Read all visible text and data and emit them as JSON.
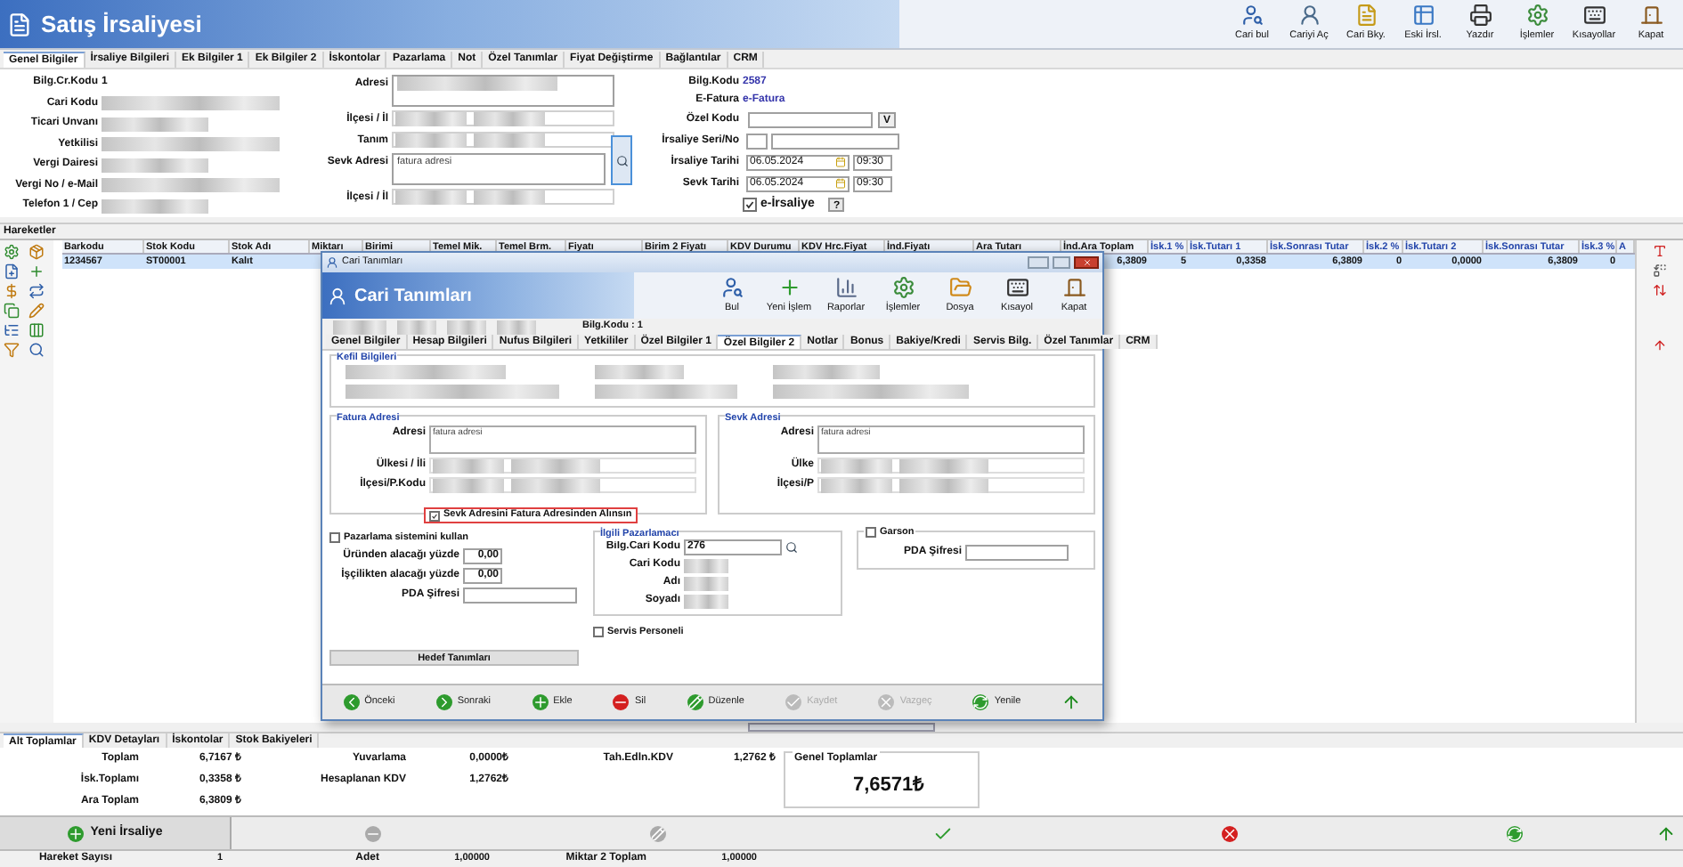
{
  "window": {
    "title": "Satış İrsaliyesi"
  },
  "toolbar": [
    {
      "label": "Cari bul"
    },
    {
      "label": "Cariyi Aç"
    },
    {
      "label": "Cari Bky."
    },
    {
      "label": "Eski İrsl."
    },
    {
      "label": "Yazdır"
    },
    {
      "label": "İşlemler"
    },
    {
      "label": "Kısayollar"
    },
    {
      "label": "Kapat"
    }
  ],
  "tabs": [
    {
      "label": "Genel Bilgiler",
      "selected": true
    },
    {
      "label": "İrsaliye Bilgileri",
      "selected": false
    },
    {
      "label": "Ek Bilgiler 1",
      "selected": false
    },
    {
      "label": "Ek Bilgiler 2",
      "selected": false
    },
    {
      "label": "İskontolar",
      "selected": false
    },
    {
      "label": "Pazarlama",
      "selected": false
    },
    {
      "label": "Not",
      "selected": false
    },
    {
      "label": "Özel Tanımlar",
      "selected": false
    },
    {
      "label": "Fiyat Değiştirme",
      "selected": false
    },
    {
      "label": "Bağlantılar",
      "selected": false
    },
    {
      "label": "CRM",
      "selected": false
    }
  ],
  "customer_fields": [
    {
      "label": "Bilg.Cr.Kodu",
      "value": "1"
    },
    {
      "label": "Cari Kodu"
    },
    {
      "label": "Ticari Unvanı"
    },
    {
      "label": "Yetkilisi"
    },
    {
      "label": "Vergi Dairesi"
    },
    {
      "label": "Vergi No / e-Mail"
    },
    {
      "label": "Telefon 1 / Cep"
    }
  ],
  "address_fields": [
    {
      "label": "Adresi",
      "kind": "area"
    },
    {
      "label": "İlçesi / İl",
      "kind": "line"
    },
    {
      "label": "Tanım",
      "kind": "line"
    },
    {
      "label": "Sevk Adresi",
      "kind": "area",
      "value": "fatura adresi"
    },
    {
      "label": "İlçesi / İl",
      "kind": "line"
    }
  ],
  "document_fields": {
    "bilg_kodu": {
      "label": "Bilg.Kodu",
      "value": "2587"
    },
    "e_fatura": {
      "label": "E-Fatura",
      "value": "e-Fatura"
    },
    "ozel_kodu": {
      "label": "Özel Kodu",
      "button": "V"
    },
    "seri_no": {
      "label": "İrsaliye Seri/No"
    },
    "irsaliye_tarihi": {
      "label": "İrsaliye Tarihi",
      "date": "06.05.2024",
      "time": "09:30"
    },
    "sevk_tarihi": {
      "label": "Sevk Tarihi",
      "date": "06.05.2024",
      "time": "09:30"
    },
    "e_irsaliye": {
      "label": "e-İrsaliye",
      "checked": true
    },
    "help_button": "?"
  },
  "movements": {
    "title": "Hareketler",
    "columns": [
      "Barkodu",
      "Stok Kodu",
      "Stok Adı",
      "Miktarı",
      "Birimi",
      "Temel Mik.",
      "Temel Brm.",
      "Fiyatı",
      "Birim 2 Fiyatı",
      "KDV Durumu",
      "KDV Hrc.Fiyat",
      "İnd.Fiyatı",
      "Ara Tutarı",
      "İnd.Ara Toplam",
      "İsk.1 %",
      "İsk.Tutarı 1",
      "İsk.Sonrası Tutar",
      "İsk.2 %",
      "İsk.Tutarı 2",
      "İsk.Sonrası Tutar",
      "İsk.3 %",
      "A"
    ],
    "rows": [
      {
        "selected": true,
        "cells": [
          "1234567",
          "ST00001",
          "Kalıt",
          null,
          null,
          null,
          null,
          null,
          null,
          null,
          null,
          null,
          null,
          "6,3809",
          "5",
          "0,3358",
          "6,3809",
          "0",
          "0,0000",
          "6,3809",
          "0",
          null
        ]
      }
    ]
  },
  "dialog": {
    "window_title": "Cari Tanımları",
    "title": "Cari Tanımları",
    "toolbar": [
      {
        "label": "Bul"
      },
      {
        "label": "Yeni İşlem"
      },
      {
        "label": "Raporlar"
      },
      {
        "label": "İşlemler"
      },
      {
        "label": "Dosya"
      },
      {
        "label": "Kısayol"
      },
      {
        "label": "Kapat"
      }
    ],
    "code": "Bilg.Kodu : 1",
    "tabs": [
      {
        "label": "Genel Bilgiler",
        "selected": false
      },
      {
        "label": "Hesap Bilgileri",
        "selected": false
      },
      {
        "label": "Nufus Bilgileri",
        "selected": false
      },
      {
        "label": "Yetkililer",
        "selected": false
      },
      {
        "label": "Özel Bilgiler 1",
        "selected": false
      },
      {
        "label": "Özel Bilgiler 2",
        "selected": true
      },
      {
        "label": "Notlar",
        "selected": false
      },
      {
        "label": "Bonus",
        "selected": false
      },
      {
        "label": "Bakiye/Kredi",
        "selected": false
      },
      {
        "label": "Servis Bilg.",
        "selected": false
      },
      {
        "label": "Özel Tanımlar",
        "selected": false
      },
      {
        "label": "CRM",
        "selected": false
      }
    ],
    "guarantor": {
      "title": "Kefil Bilgileri"
    },
    "invoice_address": {
      "title": "Fatura Adresi",
      "fields": [
        {
          "label": "Adresi",
          "value": "fatura adresi"
        },
        {
          "label": "Ülkesi / İli"
        },
        {
          "label": "İlçesi/P.Kodu"
        }
      ]
    },
    "shipping_address": {
      "title": "Sevk Adresi",
      "fields": [
        {
          "label": "Adresi",
          "value": "fatura adresi"
        },
        {
          "label": "Ülke"
        },
        {
          "label": "İlçesi/P"
        }
      ]
    },
    "same_address": {
      "label": "Sevk Adresini Fatura Adresinden Alınsın",
      "checked": true
    },
    "marketing": {
      "label": "Pazarlama sistemini kullan",
      "checked": false,
      "fields": [
        {
          "label": "Üründen alacağı yüzde",
          "value": "0,00"
        },
        {
          "label": "İşçilikten alacağı yüzde",
          "value": "0,00"
        },
        {
          "label": "PDA Şifresi"
        }
      ],
      "targets_button": "Hedef Tanımları"
    },
    "marketer": {
      "title": "İlgili Pazarlamacı",
      "fields": [
        {
          "label": "Bilg.Cari Kodu",
          "value": "276"
        },
        {
          "label": "Cari Kodu"
        },
        {
          "label": "Adı"
        },
        {
          "label": "Soyadı"
        }
      ]
    },
    "service_staff": {
      "label": "Servis Personeli",
      "checked": false
    },
    "waiter": {
      "label": "Garson",
      "checked": false,
      "fields": [
        {
          "label": "PDA Şifresi"
        }
      ]
    },
    "buttons": [
      {
        "label": "Önceki",
        "disabled": false
      },
      {
        "label": "Sonraki",
        "disabled": false
      },
      {
        "label": "Ekle",
        "disabled": false
      },
      {
        "label": "Sil",
        "disabled": false
      },
      {
        "label": "Düzenle",
        "disabled": false
      },
      {
        "label": "Kaydet",
        "disabled": true
      },
      {
        "label": "Vazgeç",
        "disabled": true
      },
      {
        "label": "Yenile",
        "disabled": false
      }
    ]
  },
  "totals": {
    "tabs": [
      {
        "label": "Alt Toplamlar",
        "selected": true
      },
      {
        "label": "KDV Detayları",
        "selected": false
      },
      {
        "label": "İskontolar",
        "selected": false
      },
      {
        "label": "Stok Bakiyeleri",
        "selected": false
      }
    ],
    "columns": [
      [
        {
          "label": "Toplam",
          "value": "6,7167 ₺"
        },
        {
          "label": "İsk.Toplamı",
          "value": "0,3358 ₺"
        },
        {
          "label": "Ara Toplam",
          "value": "6,3809 ₺"
        }
      ],
      [
        {
          "label": "Yuvarlama",
          "value": "0,0000₺"
        },
        {
          "label": "Hesaplanan KDV",
          "value": "1,2762₺"
        }
      ],
      [
        {
          "label": "Tah.Edln.KDV",
          "value": "1,2762 ₺"
        }
      ]
    ],
    "grand_total": {
      "title": "Genel Toplamlar",
      "value": "7,6571₺"
    }
  },
  "actions": {
    "new_button": "Yeni İrsaliye"
  },
  "status_bar": [
    {
      "label": "Hareket Sayısı",
      "value": "1"
    },
    {
      "label": "Adet",
      "value": "1,00000"
    },
    {
      "label": "Miktar 2 Toplam",
      "value": "1,00000"
    }
  ]
}
